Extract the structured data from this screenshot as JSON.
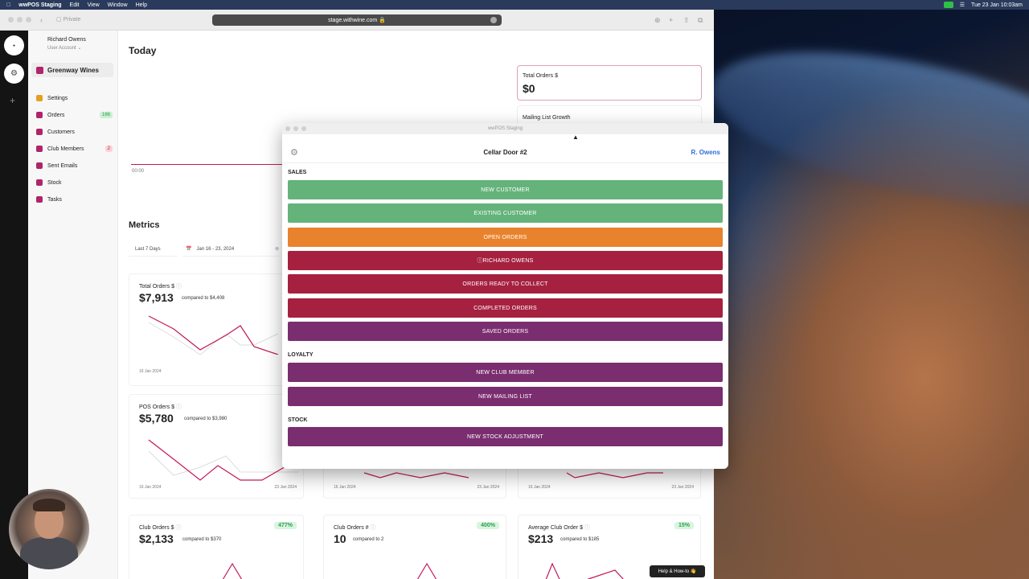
{
  "menubar": {
    "app": "wwPOS Staging",
    "items": [
      "Edit",
      "View",
      "Window",
      "Help"
    ],
    "datetime": "Tue 23 Jan  10:03am"
  },
  "browser": {
    "url": "stage.withwine.com",
    "tab_label": "Private"
  },
  "sidebar": {
    "user_name": "Richard Owens",
    "user_account": "User Account",
    "brand": "Greenway Wines",
    "items": [
      {
        "label": "Settings",
        "badge": ""
      },
      {
        "label": "Orders",
        "badge": "166"
      },
      {
        "label": "Customers",
        "badge": ""
      },
      {
        "label": "Club Members",
        "badge": "2"
      },
      {
        "label": "Sent Emails",
        "badge": ""
      },
      {
        "label": "Stock",
        "badge": ""
      },
      {
        "label": "Tasks",
        "badge": ""
      }
    ]
  },
  "main": {
    "today_title": "Today",
    "axis_start": "00:00",
    "kpi_label": "Total Orders $",
    "kpi_value": "$0",
    "mailing_label": "Mailing List Growth",
    "metrics_title": "Metrics",
    "range_label": "Last 7 Days",
    "date_range": "Jan 16 - 23, 2024"
  },
  "cards": [
    {
      "label": "Total Orders $",
      "value": "$7,913",
      "compare": "compared to $4,408",
      "pct": "",
      "d1": "16 Jan 2024",
      "d2": ""
    },
    {
      "label": "POS Orders $",
      "value": "$5,780",
      "compare": "compared to $3,980",
      "pct": "",
      "d1": "16 Jan 2024",
      "d2": "23 Jan 2024"
    },
    {
      "label": "Club Orders $",
      "value": "$2,133",
      "compare": "compared to $370",
      "pct": "477%"
    },
    {
      "label": "Club Orders #",
      "value": "10",
      "compare": "compared to 2",
      "pct": "400%"
    },
    {
      "label": "Average Club Order $",
      "value": "$213",
      "compare": "compared to $185",
      "pct": "15%"
    }
  ],
  "hidden_dates": {
    "c2_d1": "16 Jan 2024",
    "c2_d2": "23 Jan 2024",
    "c3_d1": "16 Jan 2024",
    "c3_d2": "23 Jan 2024"
  },
  "pos": {
    "window_title": "wwPOS Staging",
    "title": "Cellar Door #2",
    "user": "R. Owens",
    "sales_label": "SALES",
    "loyalty_label": "LOYALTY",
    "stock_label": "STOCK",
    "buttons": {
      "new_customer": "NEW CUSTOMER",
      "existing_customer": "EXISTING CUSTOMER",
      "open_orders": "OPEN ORDERS",
      "richard": "ⓘRICHARD OWENS",
      "ready": "ORDERS READY TO COLLECT",
      "completed": "COMPLETED ORDERS",
      "saved": "SAVED ORDERS",
      "club_member": "NEW CLUB MEMBER",
      "mailing": "NEW MAILING LIST",
      "stock_adj": "NEW STOCK ADJUSTMENT"
    }
  },
  "help_label": "Help & How-to 👋",
  "colors": {
    "green": "#64b37a",
    "orange": "#e8822d",
    "crimson": "#a5213f",
    "plum": "#7a2d6f",
    "brand": "#b0246a"
  }
}
